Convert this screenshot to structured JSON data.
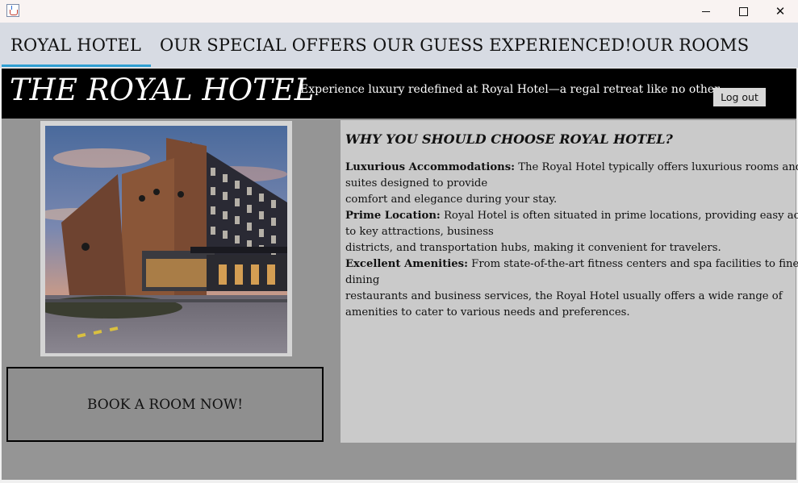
{
  "window": {
    "icon": "java-cup-icon",
    "minimize_glyph": "—",
    "maximize_glyph": "☐",
    "close_glyph": "✕"
  },
  "tabs": [
    {
      "label": "ROYAL HOTEL",
      "active": true
    },
    {
      "label": "OUR SPECIAL OFFERS",
      "active": false
    },
    {
      "label": "OUR GUESS EXPERIENCED!",
      "active": false
    },
    {
      "label": "OUR ROOMS",
      "active": false
    }
  ],
  "header": {
    "brand": "THE ROYAL HOTEL",
    "tagline": "Experience luxury redefined at Royal Hotel—a regal retreat like no other.",
    "logout_label": "Log out"
  },
  "main": {
    "photo_alt": "Royal Hotel building at dusk",
    "book_button_label": "BOOK A ROOM NOW!",
    "info": {
      "title": "WHY YOU SHOULD CHOOSE ROYAL HOTEL?",
      "sections": [
        {
          "heading": "Luxurious Accommodations:",
          "line1": " The Royal Hotel typically offers luxurious rooms and",
          "line2": "suites designed to provide",
          "line3": "comfort and elegance during your stay."
        },
        {
          "heading": "Prime Location:",
          "line1": " Royal Hotel is often situated in prime locations, providing easy access",
          "line2": "to key attractions, business",
          "line3": "districts, and transportation hubs, making it convenient for travelers."
        },
        {
          "heading": "Excellent Amenities:",
          "line1": " From state-of-the-art fitness centers and spa facilities to fine",
          "line2": "dining",
          "line3": "restaurants and business services, the Royal Hotel usually offers a wide range of",
          "line4": "amenities to cater to various needs and preferences."
        }
      ]
    }
  },
  "colors": {
    "titlebar_bg": "#f9f3f2",
    "tabbar_bg": "#d7dbe3",
    "tab_accent": "#2f9fd2",
    "header_bg": "#000000",
    "main_bg": "#959595",
    "info_bg": "#cacaca"
  }
}
